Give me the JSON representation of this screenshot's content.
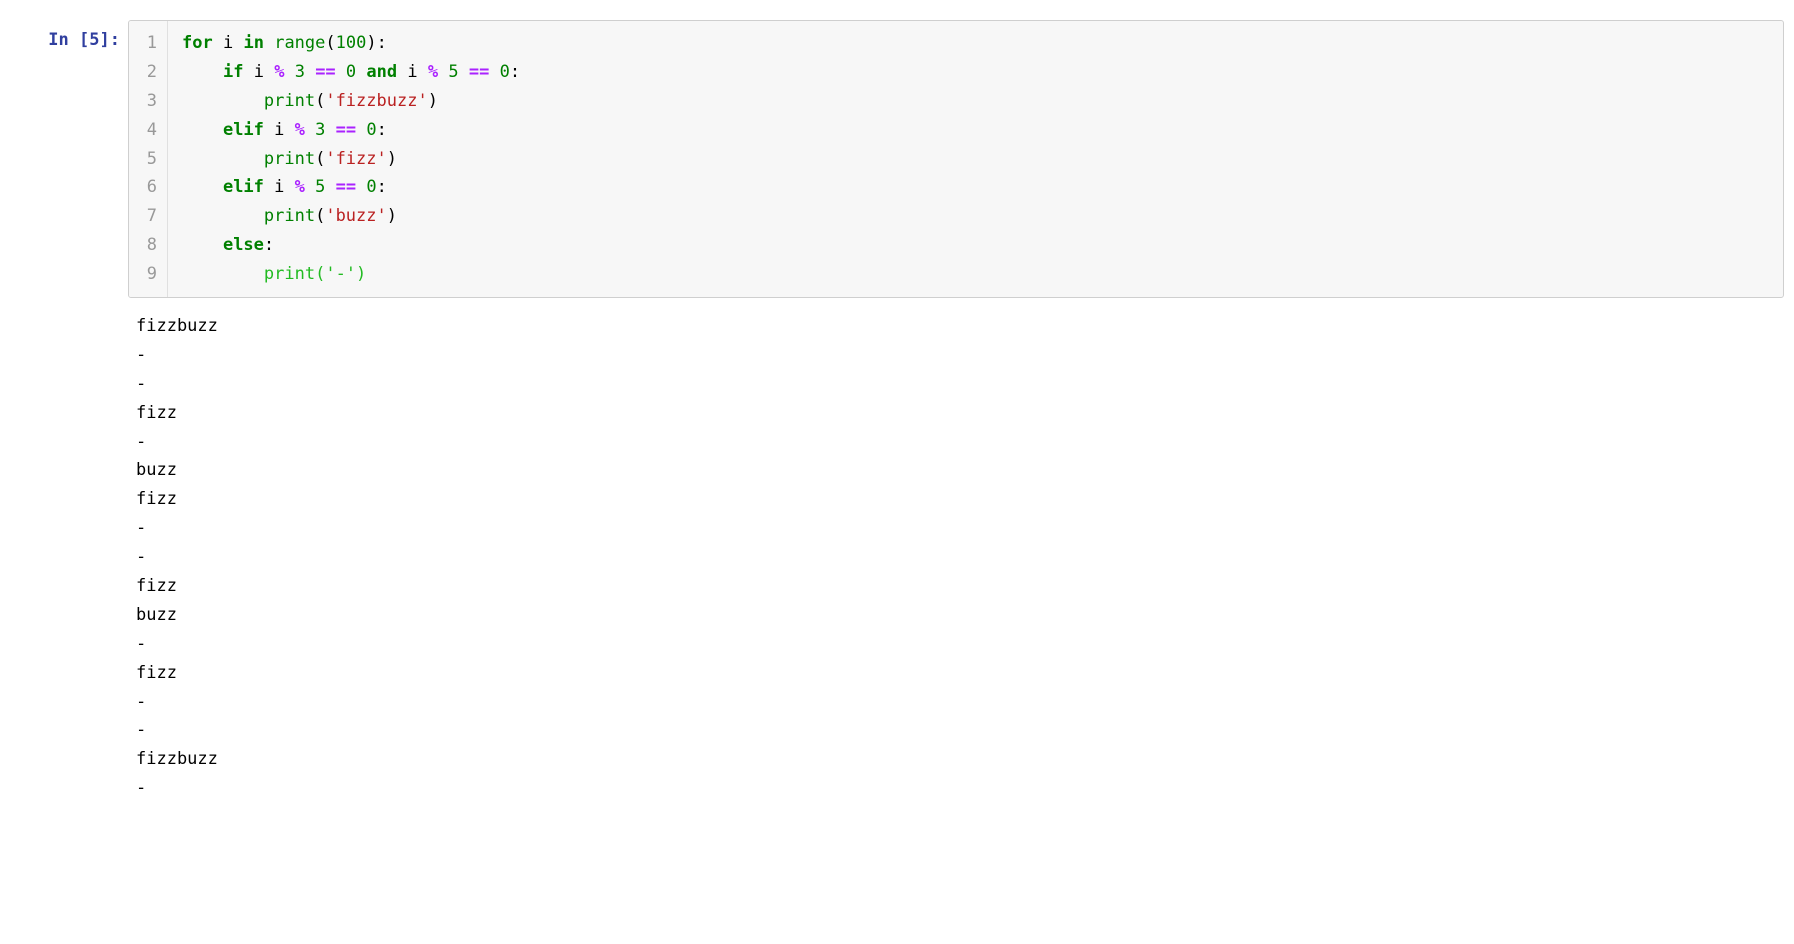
{
  "prompt": {
    "label": "In",
    "number": "5"
  },
  "code": {
    "line_numbers": [
      "1",
      "2",
      "3",
      "4",
      "5",
      "6",
      "7",
      "8",
      "9"
    ],
    "lines": [
      [
        {
          "t": "for",
          "c": "kw"
        },
        {
          "t": " ",
          "c": "sp"
        },
        {
          "t": "i",
          "c": "name"
        },
        {
          "t": " ",
          "c": "sp"
        },
        {
          "t": "in",
          "c": "kw"
        },
        {
          "t": " ",
          "c": "sp"
        },
        {
          "t": "range",
          "c": "builtin"
        },
        {
          "t": "(",
          "c": "punct"
        },
        {
          "t": "100",
          "c": "num"
        },
        {
          "t": ")",
          "c": "punct"
        },
        {
          "t": ":",
          "c": "punct"
        }
      ],
      [
        {
          "t": "    ",
          "c": "sp"
        },
        {
          "t": "if",
          "c": "kw"
        },
        {
          "t": " ",
          "c": "sp"
        },
        {
          "t": "i",
          "c": "name"
        },
        {
          "t": " ",
          "c": "sp"
        },
        {
          "t": "%",
          "c": "op"
        },
        {
          "t": " ",
          "c": "sp"
        },
        {
          "t": "3",
          "c": "num"
        },
        {
          "t": " ",
          "c": "sp"
        },
        {
          "t": "==",
          "c": "op"
        },
        {
          "t": " ",
          "c": "sp"
        },
        {
          "t": "0",
          "c": "num"
        },
        {
          "t": " ",
          "c": "sp"
        },
        {
          "t": "and",
          "c": "kw"
        },
        {
          "t": " ",
          "c": "sp"
        },
        {
          "t": "i",
          "c": "name"
        },
        {
          "t": " ",
          "c": "sp"
        },
        {
          "t": "%",
          "c": "op"
        },
        {
          "t": " ",
          "c": "sp"
        },
        {
          "t": "5",
          "c": "num"
        },
        {
          "t": " ",
          "c": "sp"
        },
        {
          "t": "==",
          "c": "op"
        },
        {
          "t": " ",
          "c": "sp"
        },
        {
          "t": "0",
          "c": "num"
        },
        {
          "t": ":",
          "c": "punct"
        }
      ],
      [
        {
          "t": "        ",
          "c": "sp"
        },
        {
          "t": "print",
          "c": "builtin"
        },
        {
          "t": "(",
          "c": "punct"
        },
        {
          "t": "'fizzbuzz'",
          "c": "str"
        },
        {
          "t": ")",
          "c": "punct"
        }
      ],
      [
        {
          "t": "    ",
          "c": "sp"
        },
        {
          "t": "elif",
          "c": "kw"
        },
        {
          "t": " ",
          "c": "sp"
        },
        {
          "t": "i",
          "c": "name"
        },
        {
          "t": " ",
          "c": "sp"
        },
        {
          "t": "%",
          "c": "op"
        },
        {
          "t": " ",
          "c": "sp"
        },
        {
          "t": "3",
          "c": "num"
        },
        {
          "t": " ",
          "c": "sp"
        },
        {
          "t": "==",
          "c": "op"
        },
        {
          "t": " ",
          "c": "sp"
        },
        {
          "t": "0",
          "c": "num"
        },
        {
          "t": ":",
          "c": "punct"
        }
      ],
      [
        {
          "t": "        ",
          "c": "sp"
        },
        {
          "t": "print",
          "c": "builtin"
        },
        {
          "t": "(",
          "c": "punct"
        },
        {
          "t": "'fizz'",
          "c": "str"
        },
        {
          "t": ")",
          "c": "punct"
        }
      ],
      [
        {
          "t": "    ",
          "c": "sp"
        },
        {
          "t": "elif",
          "c": "kw"
        },
        {
          "t": " ",
          "c": "sp"
        },
        {
          "t": "i",
          "c": "name"
        },
        {
          "t": " ",
          "c": "sp"
        },
        {
          "t": "%",
          "c": "op"
        },
        {
          "t": " ",
          "c": "sp"
        },
        {
          "t": "5",
          "c": "num"
        },
        {
          "t": " ",
          "c": "sp"
        },
        {
          "t": "==",
          "c": "op"
        },
        {
          "t": " ",
          "c": "sp"
        },
        {
          "t": "0",
          "c": "num"
        },
        {
          "t": ":",
          "c": "punct"
        }
      ],
      [
        {
          "t": "        ",
          "c": "sp"
        },
        {
          "t": "print",
          "c": "builtin"
        },
        {
          "t": "(",
          "c": "punct"
        },
        {
          "t": "'buzz'",
          "c": "str"
        },
        {
          "t": ")",
          "c": "punct"
        }
      ],
      [
        {
          "t": "    ",
          "c": "sp"
        },
        {
          "t": "else",
          "c": "kw"
        },
        {
          "t": ":",
          "c": "punct"
        }
      ],
      [
        {
          "t": "        ",
          "c": "sp"
        },
        {
          "t": "print",
          "c": "call"
        },
        {
          "t": "(",
          "c": "paren"
        },
        {
          "t": "'-'",
          "c": "strg"
        },
        {
          "t": ")",
          "c": "paren"
        }
      ]
    ],
    "active_line_index": 8
  },
  "output_lines": [
    "fizzbuzz",
    "-",
    "-",
    "fizz",
    "-",
    "buzz",
    "fizz",
    "-",
    "-",
    "fizz",
    "buzz",
    "-",
    "fizz",
    "-",
    "-",
    "fizzbuzz",
    "-"
  ]
}
